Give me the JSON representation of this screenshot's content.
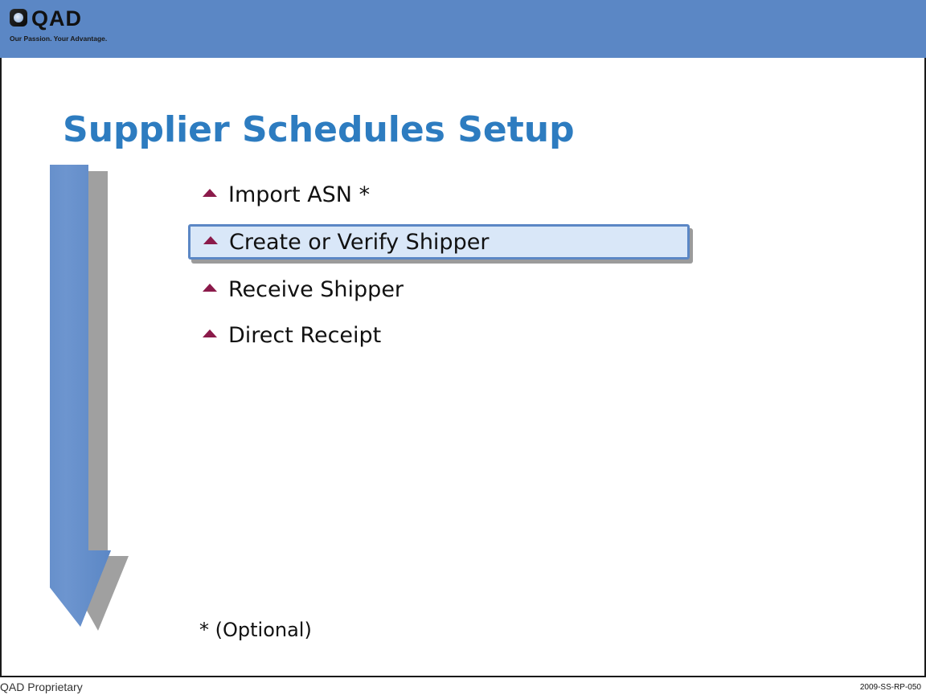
{
  "header": {
    "logo_text": "QAD",
    "tagline": "Our Passion. Your Advantage.",
    "brand_color": "#5b87c5"
  },
  "slide": {
    "title": "Supplier Schedules Setup",
    "title_color": "#2d7cc0",
    "steps": [
      {
        "label": "Import ASN *",
        "highlighted": false
      },
      {
        "label": "Create or Verify Shipper",
        "highlighted": true
      },
      {
        "label": "Receive Shipper",
        "highlighted": false
      },
      {
        "label": "Direct Receipt",
        "highlighted": false
      }
    ],
    "bullet_icon": "triangle-up-icon",
    "bullet_color": "#8b1a4a",
    "note": "* (Optional)"
  },
  "footer": {
    "left": "QAD Proprietary",
    "right": "2009-SS-RP-050"
  }
}
